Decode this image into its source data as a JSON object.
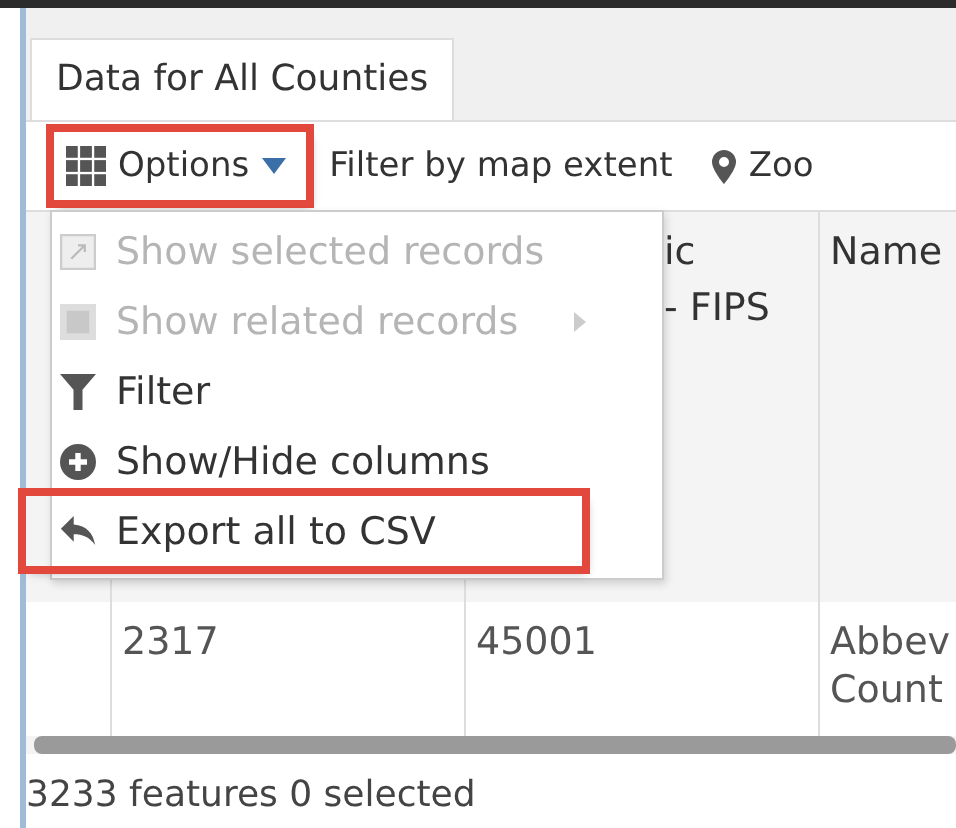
{
  "tab": {
    "label": "Data for All Counties",
    "selected": true
  },
  "toolbar": {
    "options": {
      "label": "Options",
      "highlighted": true
    },
    "filter_label": "Filter by map extent",
    "zoom_label": "Zoo"
  },
  "menu": {
    "items": [
      {
        "kind": "select",
        "label": "Show selected records",
        "disabled": true,
        "submenu": false,
        "highlighted": false
      },
      {
        "kind": "related",
        "label": "Show related records",
        "disabled": true,
        "submenu": true,
        "highlighted": false
      },
      {
        "kind": "filter",
        "label": "Filter",
        "disabled": false,
        "submenu": false,
        "highlighted": false
      },
      {
        "kind": "columns",
        "label": "Show/Hide columns",
        "disabled": false,
        "submenu": false,
        "highlighted": false
      },
      {
        "kind": "export",
        "label": "Export all to CSV",
        "disabled": false,
        "submenu": false,
        "highlighted": true
      }
    ]
  },
  "table": {
    "columns": [
      {},
      {
        "lines": [
          "ic",
          "- FIPS"
        ]
      },
      {
        "lines": [
          "Name"
        ]
      }
    ],
    "rows": [
      {
        "cells": [
          [
            "2317"
          ],
          [
            "45001"
          ],
          [
            "Abbev",
            "Count"
          ]
        ]
      }
    ]
  },
  "status_bar": "3233 features 0 selected"
}
